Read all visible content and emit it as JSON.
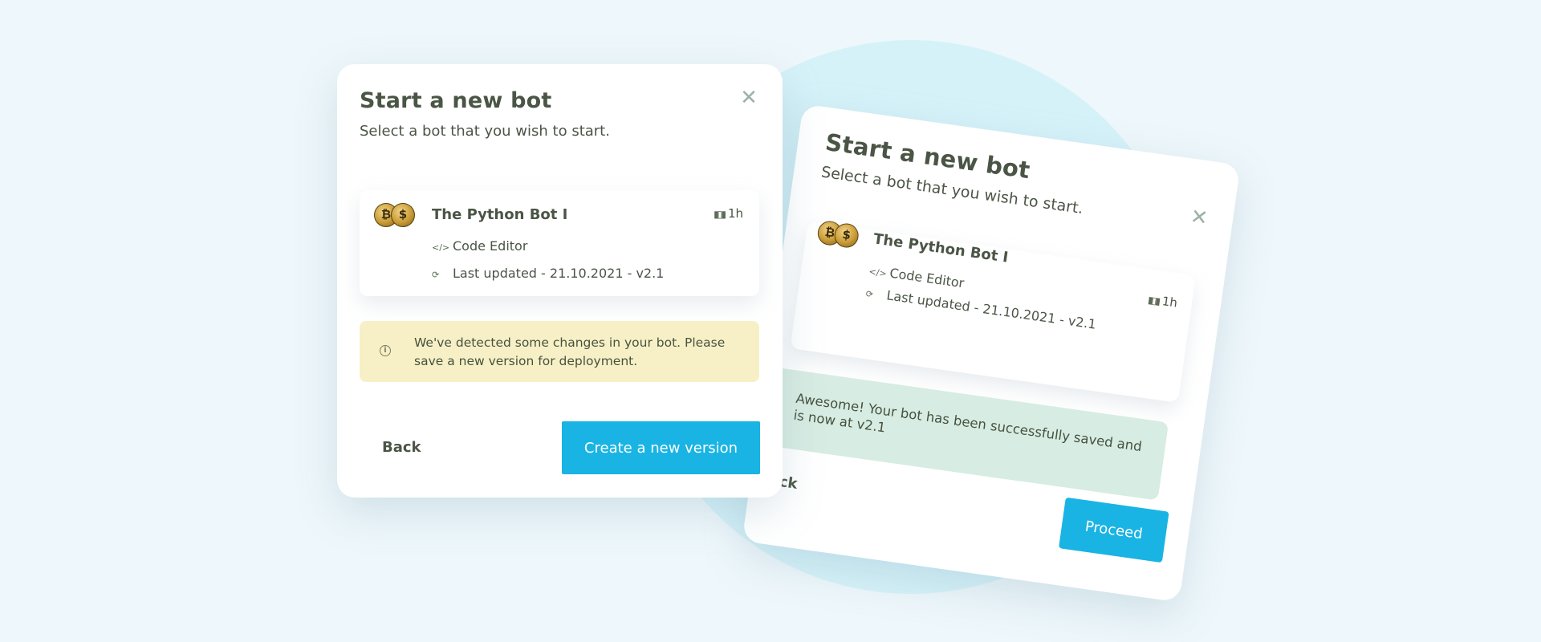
{
  "front_modal": {
    "title": "Start a new bot",
    "subtitle": "Select a bot that you wish to start.",
    "close_icon": "close-icon",
    "bot": {
      "name": "The Python Bot I",
      "duration": "1h",
      "duration_icon": "candlestick-icon",
      "editor_icon": "code-icon",
      "editor": "Code Editor",
      "updated_icon": "refresh-icon",
      "updated": "Last updated - 21.10.2021 - v2.1",
      "coin_symbol_1": "₿",
      "coin_symbol_2": "$"
    },
    "notice": {
      "icon": "info-icon",
      "text": "We've detected some changes in your bot. Please save a new version for deployment."
    },
    "back_label": "Back",
    "primary_label": "Create a new version"
  },
  "back_modal": {
    "title": "Start a new bot",
    "subtitle": "Select a bot that you wish to start.",
    "close_icon": "close-icon",
    "bot": {
      "name": "The Python Bot I",
      "duration": "1h",
      "editor": "Code Editor",
      "updated": "Last updated - 21.10.2021 - v2.1",
      "coin_symbol_1": "₿",
      "coin_symbol_2": "$"
    },
    "success": {
      "icon": "check-icon",
      "text": "Awesome! Your bot has been successfully saved and is now at v2.1"
    },
    "back_label": "Back",
    "primary_label": "Proceed"
  },
  "colors": {
    "background": "#eef7fb",
    "accent": "#19b4e3",
    "notice_bg": "#f7f0c6",
    "success_bg": "#d7ece2",
    "text": "#4a5545"
  }
}
